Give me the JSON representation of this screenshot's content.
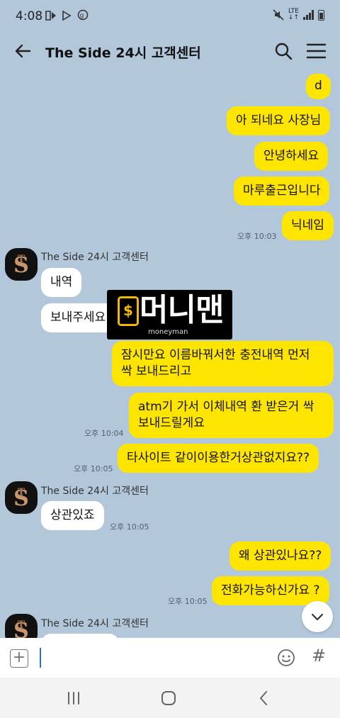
{
  "status": {
    "time": "4:08",
    "lte": "LTE"
  },
  "header": {
    "title": "The Side 24시 고객센터"
  },
  "messages": {
    "m1": "d",
    "m2": "아 되네요 사장님",
    "m3": "안녕하세요",
    "m4": "마루출근입니다",
    "m5": "닉네임",
    "t1": "오후 10:03",
    "sender": "The Side 24시 고객센터",
    "r1": "내역",
    "r2": "보내주세요",
    "m6": "잠시만요 이름바꿔서한 충전내역 먼저 싹 보내드리고",
    "m7": "atm기 가서 이체내역 환 받은거 싹 보내드릴게요",
    "t2": "오후 10:04",
    "m8": "타사이트 같이이용한거상관없지요??",
    "t3": "오후 10:05",
    "r3": "상관있죠",
    "t4": "오후 10:05",
    "m9": "왜 상관있나요??",
    "m10": "전화가능하신가요 ?",
    "t5": "오후 10:05"
  },
  "watermark": {
    "text": "머니맨",
    "sub": "moneyman",
    "symbol": "$"
  },
  "input": {
    "plus": "+",
    "hash": "#",
    "placeholder": ""
  },
  "colors": {
    "background": "#b2c7da",
    "my_bubble": "#fee500",
    "their_bubble": "#ffffff",
    "accent": "#f2b705"
  }
}
